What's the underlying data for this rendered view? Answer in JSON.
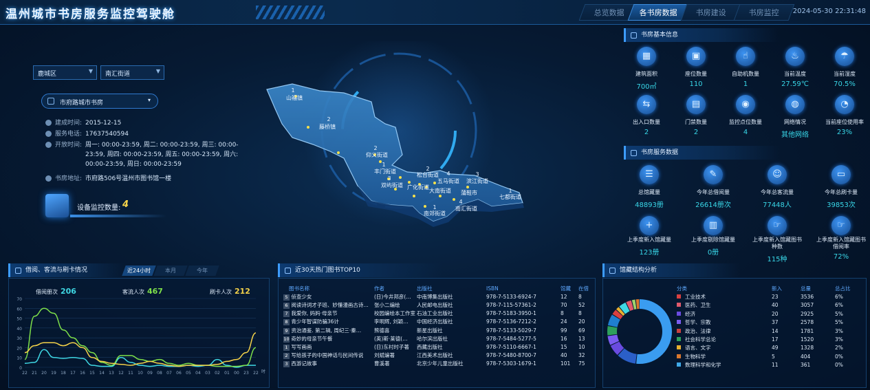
{
  "app": {
    "title": "温州城市书房服务监控驾驶舱",
    "datetime": "2024-05-30 22:31:48"
  },
  "tabs": [
    {
      "label": "总览数据"
    },
    {
      "label": "各书房数据"
    },
    {
      "label": "书房建设"
    },
    {
      "label": "书房监控"
    }
  ],
  "filters": {
    "district": "鹿城区",
    "street": "南汇街道",
    "library": "市府路城市书房"
  },
  "library_info": {
    "build_label": "建成时间:",
    "build_value": "2015-12-15",
    "phone_label": "服务电话:",
    "phone_value": "17637540594",
    "hours_label": "开放时间:",
    "hours_value": "周一: 00:00-23:59, 周二: 00:00-23:59, 周三: 00:00-23:59, 周四: 00:00-23:59, 周五: 00:00-23:59, 周六: 00:00-23:59, 周日: 00:00-23:59",
    "addr_label": "书房地址:",
    "addr_value": "市府路506号温州市图书馆一楼"
  },
  "device": {
    "label": "设备监控数量:",
    "count": "4"
  },
  "map": {
    "regions": [
      {
        "name": "山福镇",
        "count": "1"
      },
      {
        "name": "藤桥镇",
        "count": "2"
      },
      {
        "name": "仰义街道",
        "count": "2"
      },
      {
        "name": "丰门街道",
        "count": "1"
      },
      {
        "name": "双屿街道",
        "count": "3"
      },
      {
        "name": "松台街道",
        "count": "2"
      },
      {
        "name": "五马街道",
        "count": "4"
      },
      {
        "name": "滨江街道",
        "count": "3"
      },
      {
        "name": "七都街道",
        "count": "1"
      },
      {
        "name": "南郊街道",
        "count": "1"
      },
      {
        "name": "大南街道",
        "count": "1"
      },
      {
        "name": "南汇街道",
        "count": "4"
      },
      {
        "name": "广化街道",
        "count": "2"
      },
      {
        "name": "蒲鞋市",
        "count": "2"
      },
      {
        "name": "南汇",
        "count": "4"
      }
    ]
  },
  "basic": {
    "title": "书房基本信息",
    "items": [
      {
        "label": "建筑面积",
        "value": "700㎡",
        "icon": "building-icon"
      },
      {
        "label": "座位数量",
        "value": "110",
        "icon": "seat-icon"
      },
      {
        "label": "自助机数量",
        "value": "1",
        "icon": "machine-icon"
      },
      {
        "label": "当前温度",
        "value": "27.59℃",
        "icon": "thermometer-icon"
      },
      {
        "label": "当前湿度",
        "value": "70.5%",
        "icon": "humidity-icon"
      },
      {
        "label": "出入口数量",
        "value": "2",
        "icon": "entrance-icon"
      },
      {
        "label": "门禁数量",
        "value": "2",
        "icon": "gate-icon"
      },
      {
        "label": "监控点位数量",
        "value": "4",
        "icon": "camera-icon"
      },
      {
        "label": "网络情况",
        "value": "其他网络",
        "icon": "network-icon"
      },
      {
        "label": "当前座位使用率",
        "value": "23%",
        "icon": "pie-icon"
      }
    ]
  },
  "service": {
    "title": "书房服务数据",
    "items": [
      {
        "label": "总馆藏量",
        "value": "48893册",
        "icon": "books-icon"
      },
      {
        "label": "今年总借阅量",
        "value": "26614册次",
        "icon": "borrow-icon"
      },
      {
        "label": "今年总客流量",
        "value": "77448人",
        "icon": "people-icon"
      },
      {
        "label": "今年总刷卡量",
        "value": "39853次",
        "icon": "card-icon"
      },
      {
        "label": "上季度新入馆藏量",
        "value": "123册",
        "icon": "add-icon"
      },
      {
        "label": "上季度剔除馆藏量",
        "value": "0册",
        "icon": "trash-icon"
      },
      {
        "label": "上季度新入馆藏图书种数",
        "value": "115种",
        "icon": "hand-icon"
      },
      {
        "label": "上季度新入馆藏图书借阅率",
        "value": "72%",
        "icon": "hand-icon"
      }
    ]
  },
  "traffic": {
    "title": "借阅、客流与刷卡情况",
    "tabs": [
      "近24小时",
      "本月",
      "今年"
    ],
    "kpis": [
      {
        "label": "借阅册次",
        "value": "206",
        "color": "#3fd8e4"
      },
      {
        "label": "客流人次",
        "value": "467",
        "color": "#7ee04a"
      },
      {
        "label": "刷卡人次",
        "value": "212",
        "color": "#f5d34a"
      }
    ]
  },
  "chart_data": {
    "type": "line",
    "x": [
      "22",
      "21",
      "20",
      "19",
      "18",
      "17",
      "16",
      "15",
      "14",
      "13",
      "12",
      "11",
      "10",
      "09",
      "08",
      "07",
      "06",
      "05",
      "04",
      "03",
      "02",
      "01",
      "00",
      "23",
      "22"
    ],
    "xlabel": "时",
    "ylim": [
      0,
      70
    ],
    "yticks": [
      "0",
      "10",
      "20",
      "30",
      "40",
      "50",
      "60",
      "70"
    ],
    "grid": true,
    "series": [
      {
        "name": "借阅册次",
        "color": "#3fd8e4",
        "values": [
          4,
          5,
          18,
          10,
          9,
          10,
          9,
          2,
          1,
          1,
          10,
          5,
          2,
          1,
          2,
          1,
          1,
          2,
          1,
          2,
          8,
          2,
          0,
          2,
          2
        ]
      },
      {
        "name": "客流人次",
        "color": "#7ee04a",
        "values": [
          8,
          52,
          60,
          55,
          38,
          30,
          22,
          15,
          5,
          2,
          12,
          12,
          8,
          6,
          8,
          4,
          2,
          4,
          2,
          2,
          1,
          1,
          1,
          2,
          20
        ]
      },
      {
        "name": "刷卡人次",
        "color": "#f5d34a",
        "values": [
          15,
          22,
          25,
          25,
          22,
          25,
          20,
          10,
          6,
          4,
          3,
          2,
          4,
          6,
          4,
          2,
          1,
          2,
          2,
          2,
          3,
          6,
          8,
          15,
          35
        ]
      }
    ]
  },
  "top": {
    "title": "近30天热门图书TOP10",
    "headers": [
      "图书名称",
      "作者",
      "出版社",
      "ISBN",
      "馆藏",
      "在借"
    ],
    "rows": [
      {
        "no": "5",
        "name": "侦查少女",
        "author": "(日)今井邦彦(…",
        "pub": "中南博集出版社",
        "isbn": "978-7-5133-6924-7",
        "hold": "12",
        "out": "8"
      },
      {
        "no": "6",
        "name": "阅读诗词才子班、妙懂漫画古诗…",
        "author": "张小二编绘",
        "pub": "人民邮电出版社",
        "isbn": "978-7-115-57361-2",
        "hold": "70",
        "out": "52"
      },
      {
        "no": "7",
        "name": "我爱你, 妈妈·母亲节",
        "author": "校园编绘本工作室",
        "pub": "石油工业出版社",
        "isbn": "978-7-5183-3950-1",
        "hold": "8",
        "out": "8"
      },
      {
        "no": "8",
        "name": "青少年智谋防骗36计",
        "author": "李明辉, 刘颖…",
        "pub": "中国经济出版社",
        "isbn": "978-7-5136-7212-2",
        "hold": "24",
        "out": "20"
      },
      {
        "no": "9",
        "name": "资治通鉴. 第二辑, 周纪三·秦…",
        "author": "熊德喜",
        "pub": "新星出版社",
        "isbn": "978-7-5133-5029-7",
        "hold": "99",
        "out": "69"
      },
      {
        "no": "10",
        "name": "奇妙的母亲节午餐",
        "author": "(英)斯·莱德(…",
        "pub": "哈尔滨出版社",
        "isbn": "978-7-5484-5277-5",
        "hold": "16",
        "out": "13"
      },
      {
        "no": "1",
        "name": "写写画画",
        "author": "(日)东村时子著",
        "pub": "西藏出版社",
        "isbn": "978-7-5110-6667-1",
        "hold": "15",
        "out": "10"
      },
      {
        "no": "2",
        "name": "写给孩子的中国神话与民间传说",
        "author": "刘斌编著",
        "pub": "江西美术出版社",
        "isbn": "978-7-5480-8700-7",
        "hold": "40",
        "out": "32"
      },
      {
        "no": "3",
        "name": "西游记故事",
        "author": "曹溪著",
        "pub": "北京少年儿童出版社",
        "isbn": "978-7-5303-1679-1",
        "hold": "101",
        "out": "75"
      }
    ]
  },
  "structure": {
    "title": "馆藏结构分析",
    "headers": [
      "分类",
      "新入",
      "总量",
      "总占比"
    ],
    "rows": [
      {
        "name": "工业技术",
        "color": "#d94040",
        "new": "23",
        "total": "3536",
        "pct": "6%"
      },
      {
        "name": "医药、卫生",
        "color": "#e05a6c",
        "new": "40",
        "total": "3057",
        "pct": "6%"
      },
      {
        "name": "经济",
        "color": "#6a4be0",
        "new": "20",
        "total": "2925",
        "pct": "5%"
      },
      {
        "name": "哲学、宗教",
        "color": "#7a5cf0",
        "new": "37",
        "total": "2578",
        "pct": "5%"
      },
      {
        "name": "政治、法律",
        "color": "#c84040",
        "new": "14",
        "total": "1781",
        "pct": "3%"
      },
      {
        "name": "社会科学总论",
        "color": "#2ea05c",
        "new": "17",
        "total": "1520",
        "pct": "3%"
      },
      {
        "name": "语言、文字",
        "color": "#e8b030",
        "new": "49",
        "total": "1328",
        "pct": "2%"
      },
      {
        "name": "生物科学",
        "color": "#d9772e",
        "new": "5",
        "total": "404",
        "pct": "0%"
      },
      {
        "name": "数理科学和化学",
        "color": "#3fa9e8",
        "new": "11",
        "total": "361",
        "pct": "0%"
      }
    ],
    "donut": [
      {
        "color": "#3a9cf0",
        "value": 52
      },
      {
        "color": "#2b5fc8",
        "value": 10
      },
      {
        "color": "#6a4be0",
        "value": 6
      },
      {
        "color": "#7a5cf0",
        "value": 5
      },
      {
        "color": "#2ea05c",
        "value": 5
      },
      {
        "color": "#1f7fd0",
        "value": 6
      },
      {
        "color": "#d94040",
        "value": 3
      },
      {
        "color": "#e8b030",
        "value": 2
      },
      {
        "color": "#3fd8e4",
        "value": 4
      },
      {
        "color": "#e05a6c",
        "value": 3
      },
      {
        "color": "#9fd36c",
        "value": 2
      },
      {
        "color": "#d9772e",
        "value": 2
      }
    ]
  }
}
